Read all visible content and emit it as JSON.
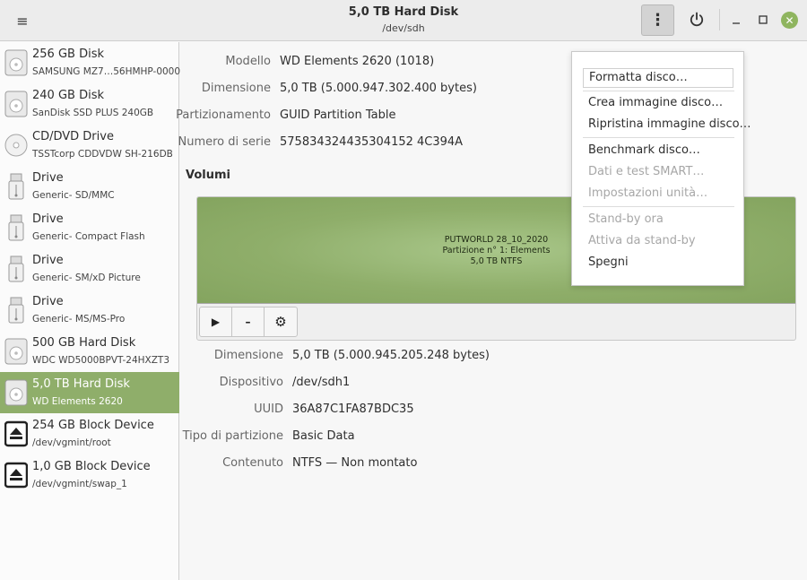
{
  "header": {
    "title": "5,0 TB Hard Disk",
    "subtitle": "/dev/sdh",
    "menu_glyph": "≡",
    "kebab_glyph": "⋮",
    "power_glyph": "⏻",
    "minimize_glyph": "–",
    "maximize_glyph": "□",
    "close_glyph": "✕",
    "accent_close": "#8fb55f"
  },
  "sidebar": {
    "selected_color": "#8fae6a",
    "items": [
      {
        "name": "256 GB Disk",
        "sub": "SAMSUNG MZ7…56HMHP-00000",
        "icon": "hard-disk-icon"
      },
      {
        "name": "240 GB Disk",
        "sub": "SanDisk SSD PLUS 240GB",
        "icon": "hard-disk-icon"
      },
      {
        "name": "CD/DVD Drive",
        "sub": "TSSTcorp CDDVDW SH-216DB",
        "icon": "optical-disc-icon"
      },
      {
        "name": "Drive",
        "sub": "Generic- SD/MMC",
        "icon": "usb-drive-icon"
      },
      {
        "name": "Drive",
        "sub": "Generic- Compact Flash",
        "icon": "usb-drive-icon"
      },
      {
        "name": "Drive",
        "sub": "Generic- SM/xD Picture",
        "icon": "usb-drive-icon"
      },
      {
        "name": "Drive",
        "sub": "Generic- MS/MS-Pro",
        "icon": "usb-drive-icon"
      },
      {
        "name": "500 GB Hard Disk",
        "sub": "WDC WD5000BPVT-24HXZT3",
        "icon": "hard-disk-icon"
      },
      {
        "name": "5,0 TB Hard Disk",
        "sub": "WD Elements 2620",
        "icon": "hard-disk-icon",
        "selected": true
      },
      {
        "name": "254 GB Block Device",
        "sub": "/dev/vgmint/root",
        "icon": "eject-icon"
      },
      {
        "name": "1,0 GB Block Device",
        "sub": "/dev/vgmint/swap_1",
        "icon": "eject-icon"
      }
    ]
  },
  "disk": {
    "model_label": "Modello",
    "model": "WD Elements 2620 (1018)",
    "size_label": "Dimensione",
    "size": "5,0 TB (5.000.947.302.400 bytes)",
    "partitioning_label": "Partizionamento",
    "partitioning": "GUID Partition Table",
    "serial_label": "Numero di serie",
    "serial": "575834324435304152 4C394A"
  },
  "volumes": {
    "title": "Volumi",
    "partition": {
      "line1": "PUTWORLD 28_10_2020",
      "line2": "Partizione n° 1: Elements",
      "line3": "5,0 TB NTFS",
      "color": "#8fae6a"
    },
    "toolbar": {
      "play": "▶",
      "minus": "–",
      "gear": "⚙"
    }
  },
  "volume_details": {
    "size_label": "Dimensione",
    "size": "5,0 TB (5.000.945.205.248 bytes)",
    "device_label": "Dispositivo",
    "device": "/dev/sdh1",
    "uuid_label": "UUID",
    "uuid": "36A87C1FA87BDC35",
    "part_type_label": "Tipo di partizione",
    "part_type": "Basic Data",
    "contents_label": "Contenuto",
    "contents": "NTFS — Non montato"
  },
  "menu": {
    "format": "Formatta disco…",
    "create_image": "Crea immagine disco…",
    "restore_image": "Ripristina immagine disco…",
    "benchmark": "Benchmark disco…",
    "smart": "Dati e test SMART…",
    "settings": "Impostazioni unità…",
    "standby_now": "Stand-by ora",
    "wake": "Attiva da stand-by",
    "power_off": "Spegni"
  }
}
